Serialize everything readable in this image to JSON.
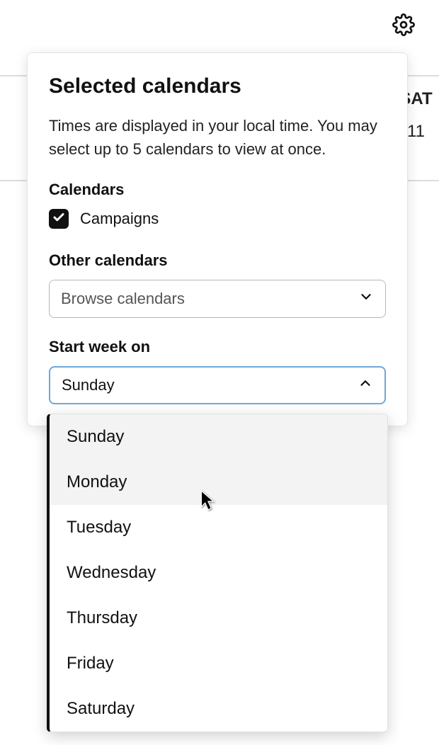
{
  "topbar": {
    "settings_icon": "gear-icon"
  },
  "calendar": {
    "day_label": "SAT",
    "day_number": "11"
  },
  "popover": {
    "title": "Selected calendars",
    "description": "Times are displayed in your local time. You may select up to 5 calendars to view at once.",
    "calendars_label": "Calendars",
    "calendar_items": [
      {
        "label": "Campaigns",
        "checked": true
      }
    ],
    "other_calendars_label": "Other calendars",
    "browse_placeholder": "Browse calendars",
    "start_week_label": "Start week on",
    "start_week_value": "Sunday",
    "start_week_options": [
      "Sunday",
      "Monday",
      "Tuesday",
      "Wednesday",
      "Thursday",
      "Friday",
      "Saturday"
    ],
    "hovered_option_index": 1,
    "selected_option_index": 0
  }
}
